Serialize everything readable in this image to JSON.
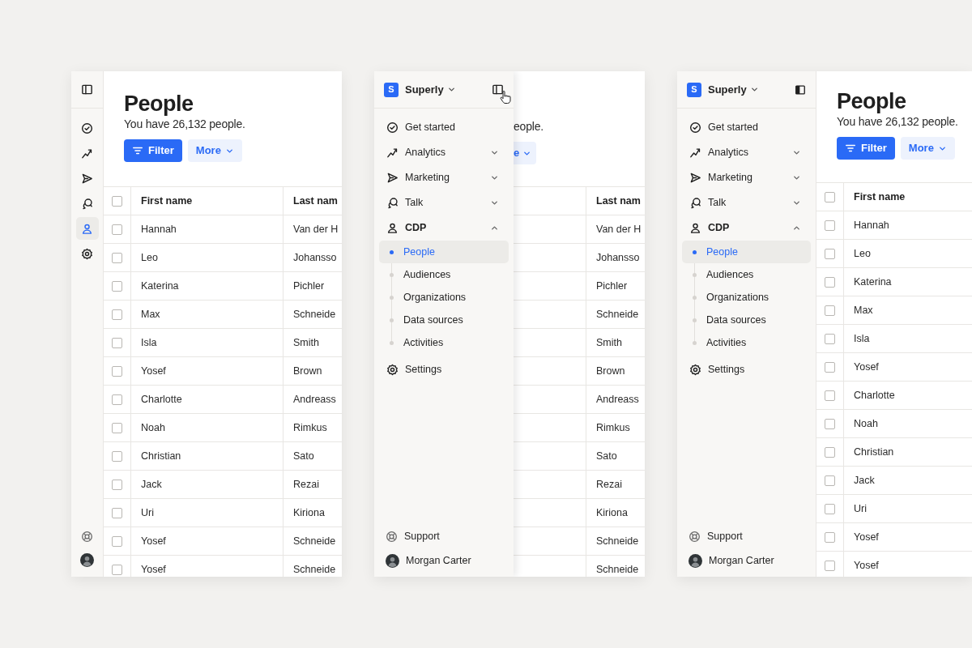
{
  "panels": [
    {
      "kind": "collapsed",
      "rail": {
        "items": [
          {
            "selected": false
          },
          {
            "selected": false
          },
          {
            "selected": false
          },
          {
            "selected": false
          },
          {
            "selected": true
          },
          {
            "selected": false
          }
        ]
      },
      "page": {
        "title": "People",
        "subtitle": "You have 26,132 people.",
        "filter_button": "Filter",
        "more_button": "More",
        "table": {
          "columns": [
            "First name",
            "Last nam"
          ],
          "header_checked": false,
          "rows": [
            {
              "checked": false,
              "cells": [
                "Hannah",
                "Van der H"
              ]
            },
            {
              "checked": false,
              "cells": [
                "Leo",
                "Johansso"
              ]
            },
            {
              "checked": false,
              "cells": [
                "Katerina",
                "Pichler"
              ]
            },
            {
              "checked": false,
              "cells": [
                "Max",
                "Schneide"
              ]
            },
            {
              "checked": false,
              "cells": [
                "Isla",
                "Smith"
              ]
            },
            {
              "checked": false,
              "cells": [
                "Yosef",
                "Brown"
              ]
            },
            {
              "checked": false,
              "cells": [
                "Charlotte",
                "Andreass"
              ]
            },
            {
              "checked": false,
              "cells": [
                "Noah",
                "Rimkus"
              ]
            },
            {
              "checked": false,
              "cells": [
                "Christian",
                "Sato"
              ]
            },
            {
              "checked": false,
              "cells": [
                "Jack",
                "Rezai"
              ]
            },
            {
              "checked": false,
              "cells": [
                "Uri",
                "Kiriona"
              ]
            },
            {
              "checked": false,
              "cells": [
                "Yosef",
                "Schneide"
              ]
            },
            {
              "checked": false,
              "cells": [
                "Yosef",
                "Schneide"
              ]
            }
          ]
        }
      }
    },
    {
      "kind": "overlay",
      "sidebar": {
        "logo": "S",
        "workspace": "Superly",
        "nav": [
          {
            "kind": "link",
            "label": "Get started"
          },
          {
            "kind": "group",
            "label": "Analytics",
            "expanded": false
          },
          {
            "kind": "group",
            "label": "Marketing",
            "expanded": false
          },
          {
            "kind": "group",
            "label": "Talk",
            "expanded": false
          },
          {
            "kind": "group",
            "label": "CDP",
            "expanded": true,
            "children": [
              {
                "label": "People",
                "selected": true
              },
              {
                "label": "Audiences",
                "selected": false
              },
              {
                "label": "Organizations",
                "selected": false
              },
              {
                "label": "Data sources",
                "selected": false
              },
              {
                "label": "Activities",
                "selected": false
              }
            ]
          },
          {
            "kind": "link",
            "label": "Settings"
          }
        ],
        "footer": [
          {
            "kind": "support",
            "label": "Support"
          },
          {
            "kind": "user",
            "label": "Morgan Carter"
          }
        ]
      },
      "page": {
        "subtitle": "eople.",
        "more_button": "e",
        "table": {
          "columns": [
            "Last nam"
          ],
          "rows": [
            {
              "cells": [
                "Van der H"
              ]
            },
            {
              "cells": [
                "Johansso"
              ]
            },
            {
              "cells": [
                "Pichler"
              ]
            },
            {
              "cells": [
                "Schneide"
              ]
            },
            {
              "cells": [
                "Smith"
              ]
            },
            {
              "cells": [
                "Brown"
              ]
            },
            {
              "cells": [
                "Andreass"
              ]
            },
            {
              "cells": [
                "Rimkus"
              ]
            },
            {
              "cells": [
                "Sato"
              ]
            },
            {
              "cells": [
                "Rezai"
              ]
            },
            {
              "cells": [
                "Kiriona"
              ]
            },
            {
              "cells": [
                "Schneide"
              ]
            },
            {
              "cells": [
                "Schneide"
              ]
            }
          ]
        }
      }
    },
    {
      "kind": "expanded",
      "sidebar": {
        "logo": "S",
        "workspace": "Superly",
        "nav": [
          {
            "kind": "link",
            "label": "Get started"
          },
          {
            "kind": "group",
            "label": "Analytics",
            "expanded": false
          },
          {
            "kind": "group",
            "label": "Marketing",
            "expanded": false
          },
          {
            "kind": "group",
            "label": "Talk",
            "expanded": false
          },
          {
            "kind": "group",
            "label": "CDP",
            "expanded": true,
            "children": [
              {
                "label": "People",
                "selected": true
              },
              {
                "label": "Audiences",
                "selected": false
              },
              {
                "label": "Organizations",
                "selected": false
              },
              {
                "label": "Data sources",
                "selected": false
              },
              {
                "label": "Activities",
                "selected": false
              }
            ]
          },
          {
            "kind": "link",
            "label": "Settings"
          }
        ],
        "footer": [
          {
            "kind": "support",
            "label": "Support"
          },
          {
            "kind": "user",
            "label": "Morgan Carter"
          }
        ]
      },
      "page": {
        "title": "People",
        "subtitle": "You have 26,132 people.",
        "filter_button": "Filter",
        "more_button": "More",
        "table": {
          "columns": [
            "First name"
          ],
          "header_checked": false,
          "rows": [
            {
              "checked": false,
              "cells": [
                "Hannah"
              ]
            },
            {
              "checked": false,
              "cells": [
                "Leo"
              ]
            },
            {
              "checked": false,
              "cells": [
                "Katerina"
              ]
            },
            {
              "checked": false,
              "cells": [
                "Max"
              ]
            },
            {
              "checked": false,
              "cells": [
                "Isla"
              ]
            },
            {
              "checked": false,
              "cells": [
                "Yosef"
              ]
            },
            {
              "checked": false,
              "cells": [
                "Charlotte"
              ]
            },
            {
              "checked": false,
              "cells": [
                "Noah"
              ]
            },
            {
              "checked": false,
              "cells": [
                "Christian"
              ]
            },
            {
              "checked": false,
              "cells": [
                "Jack"
              ]
            },
            {
              "checked": false,
              "cells": [
                "Uri"
              ]
            },
            {
              "checked": false,
              "cells": [
                "Yosef"
              ]
            },
            {
              "checked": false,
              "cells": [
                "Yosef"
              ]
            }
          ]
        }
      }
    }
  ]
}
